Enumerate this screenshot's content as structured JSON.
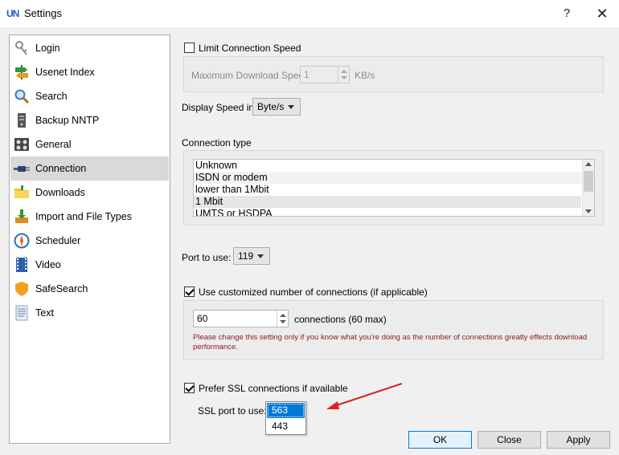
{
  "window": {
    "title": "Settings",
    "logo_text": "UN",
    "help_glyph": "?",
    "close_glyph": "✕"
  },
  "sidebar": {
    "items": [
      {
        "label": "Login",
        "icon": "keys-icon",
        "selected": false
      },
      {
        "label": "Usenet Index",
        "icon": "signpost-icon",
        "selected": false
      },
      {
        "label": "Search",
        "icon": "magnifier-icon",
        "selected": false
      },
      {
        "label": "Backup NNTP",
        "icon": "server-icon",
        "selected": false
      },
      {
        "label": "General",
        "icon": "equipment-icon",
        "selected": false
      },
      {
        "label": "Connection",
        "icon": "plug-icon",
        "selected": true
      },
      {
        "label": "Downloads",
        "icon": "folder-icon",
        "selected": false
      },
      {
        "label": "Import and File Types",
        "icon": "import-icon",
        "selected": false
      },
      {
        "label": "Scheduler",
        "icon": "compass-icon",
        "selected": false
      },
      {
        "label": "Video",
        "icon": "film-icon",
        "selected": false
      },
      {
        "label": "SafeSearch",
        "icon": "shield-icon",
        "selected": false
      },
      {
        "label": "Text",
        "icon": "document-icon",
        "selected": false
      }
    ]
  },
  "speed": {
    "limit_label": "Limit Connection Speed",
    "limit_checked": false,
    "max_label": "Maximum Download Speed",
    "max_value": "1",
    "max_unit": "KB/s",
    "display_label": "Display Speed in:",
    "display_value": "Byte/s"
  },
  "connection_type": {
    "label": "Connection type",
    "options": [
      "Unknown",
      "ISDN or modem",
      "lower than 1Mbit",
      "1 Mbit",
      "UMTS or HSDPA"
    ]
  },
  "port": {
    "label": "Port to use:",
    "value": "119"
  },
  "connections": {
    "custom_label": "Use customized number of connections (if applicable)",
    "custom_checked": true,
    "value": "60",
    "suffix": "connections (60 max)",
    "warning": "Please change this setting only if you know what you're doing as the number of connections greatly effects download performance."
  },
  "ssl": {
    "prefer_label": "Prefer SSL connections if available",
    "prefer_checked": true,
    "port_label": "SSL port to use:",
    "options": [
      "563",
      "443"
    ],
    "selected": "563"
  },
  "buttons": {
    "ok": "OK",
    "close": "Close",
    "apply": "Apply"
  },
  "colors": {
    "accent": "#0078d7",
    "annotation_arrow": "#e02020",
    "warning_text": "#8b1a1a"
  }
}
